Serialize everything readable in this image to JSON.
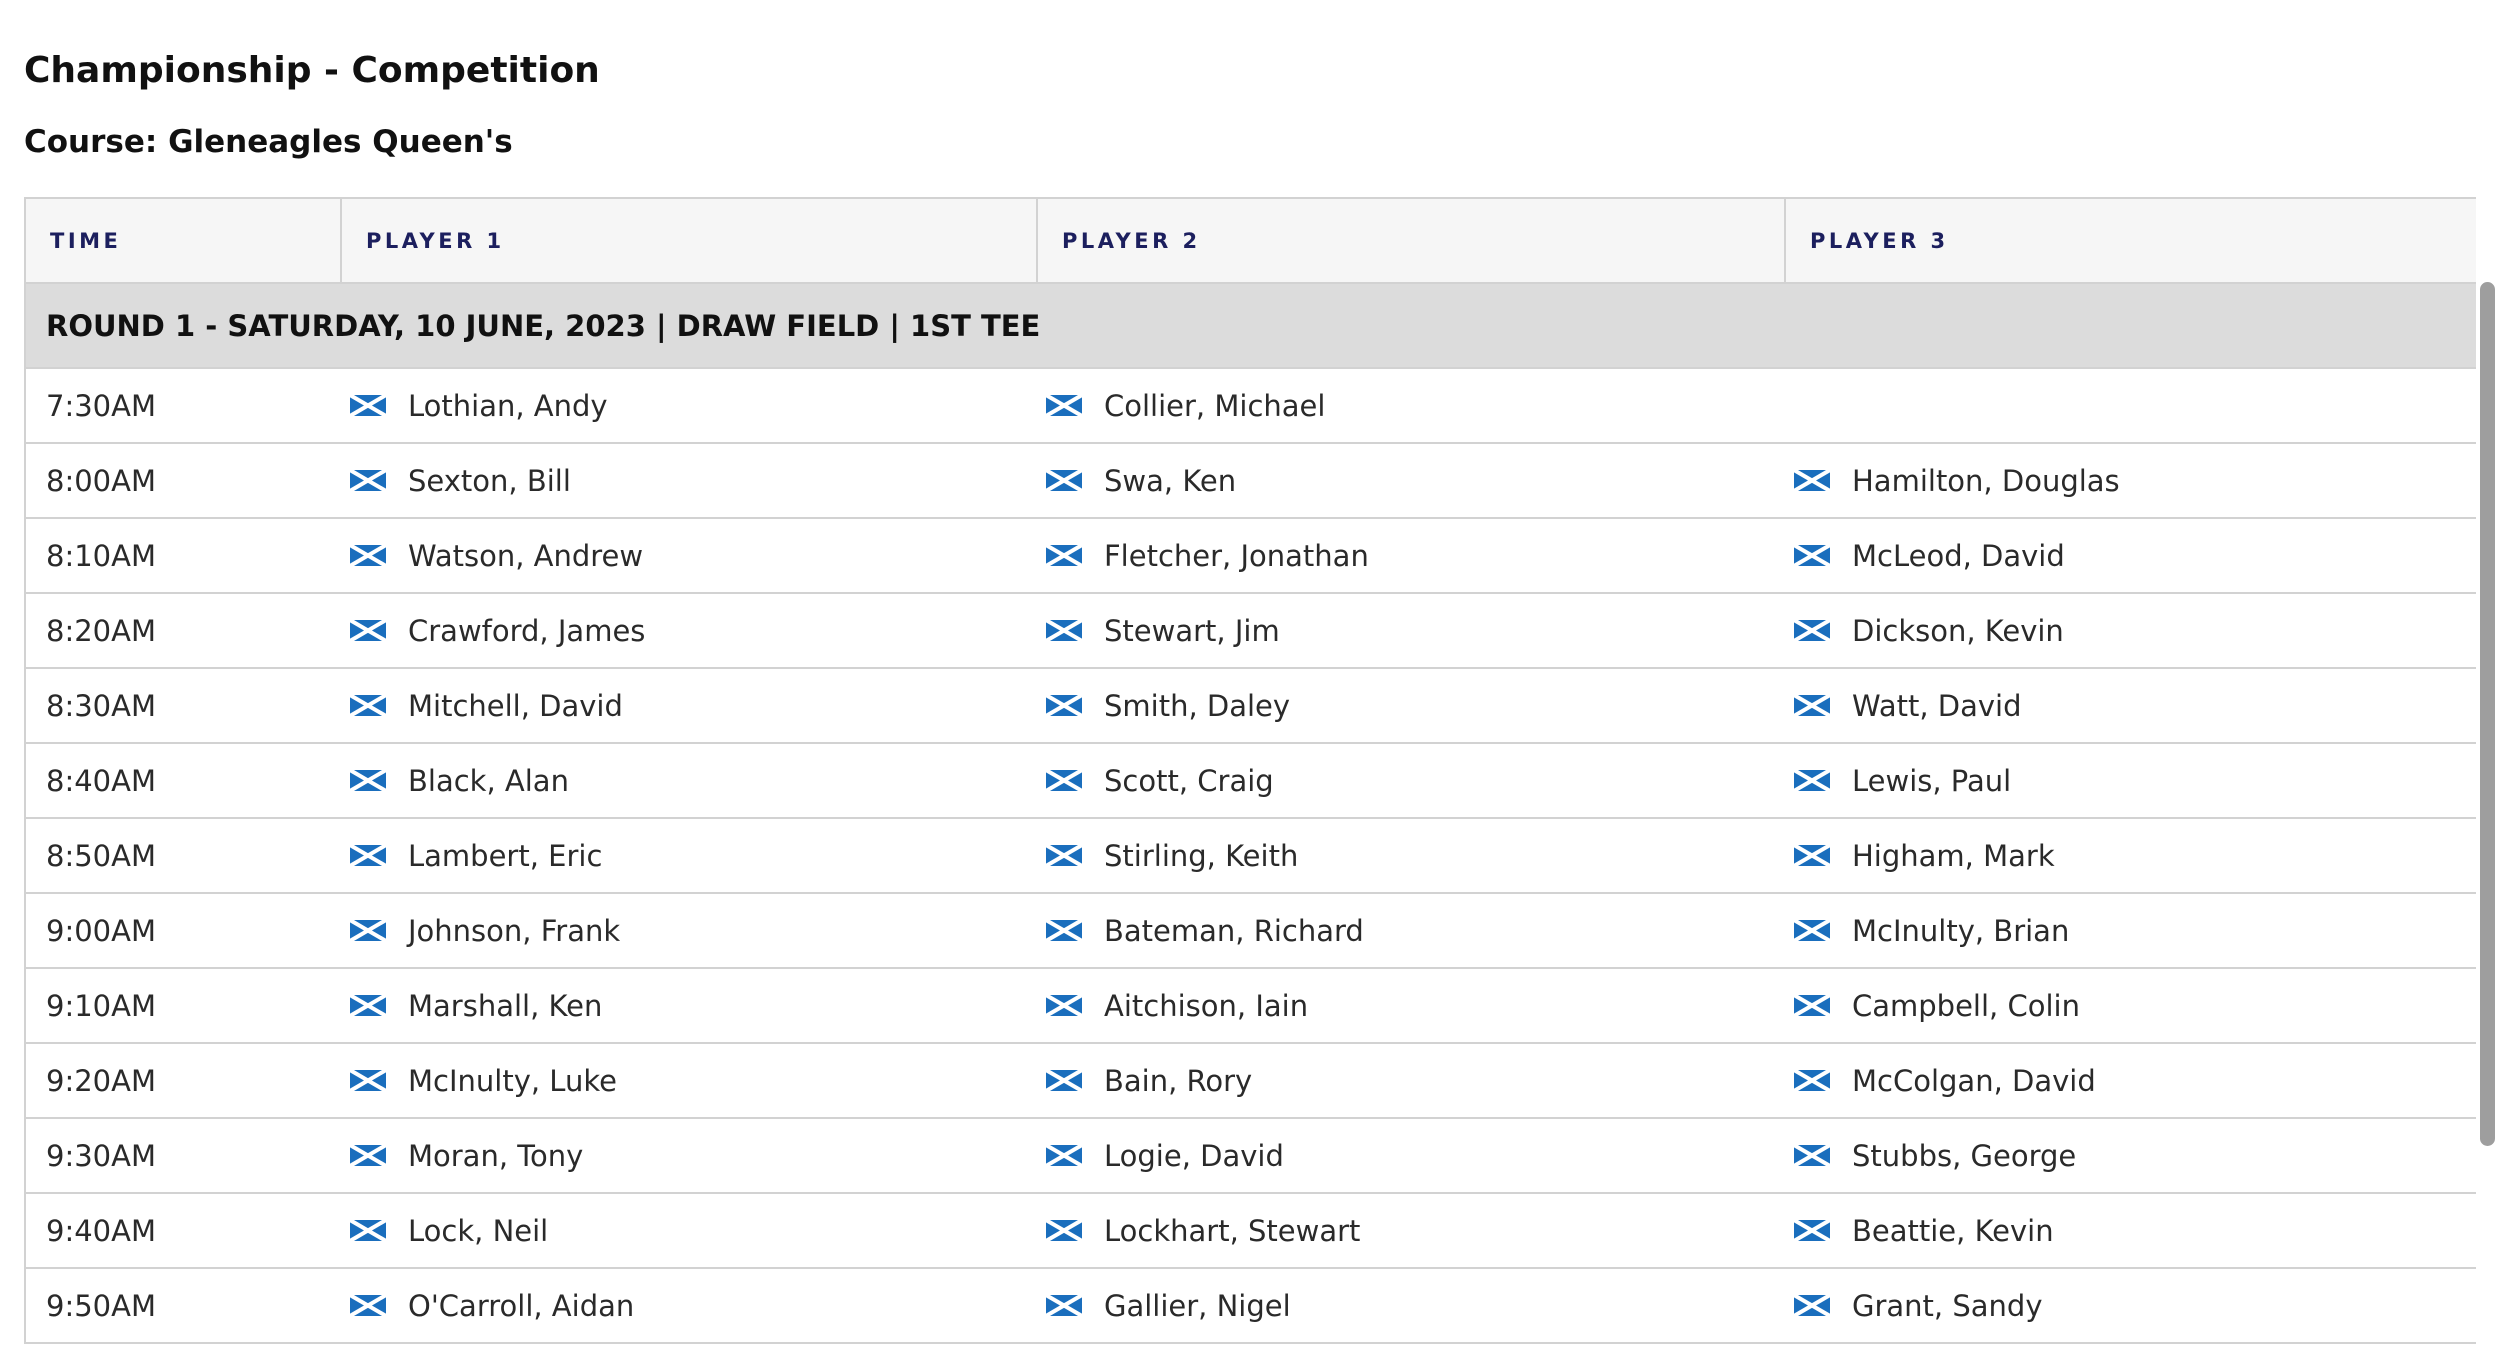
{
  "page": {
    "title": "Championship - Competition",
    "course": "Course: Gleneagles Queen's"
  },
  "table": {
    "headers": {
      "time": "TIME",
      "player1": "PLAYER 1",
      "player2": "PLAYER 2",
      "player3": "PLAYER 3"
    },
    "round_label": "ROUND 1 - SATURDAY, 10 JUNE, 2023 | DRAW FIELD | 1ST TEE",
    "flag_icon": "scotland-flag-icon",
    "flag_colors": {
      "blue": "#1a6ebd",
      "white": "#ffffff"
    },
    "rows": [
      {
        "time": "7:30AM",
        "p1": "Lothian, Andy",
        "p2": "Collier, Michael",
        "p3": ""
      },
      {
        "time": "8:00AM",
        "p1": "Sexton, Bill",
        "p2": "Swa, Ken",
        "p3": "Hamilton, Douglas"
      },
      {
        "time": "8:10AM",
        "p1": "Watson, Andrew",
        "p2": "Fletcher, Jonathan",
        "p3": "McLeod, David"
      },
      {
        "time": "8:20AM",
        "p1": "Crawford, James",
        "p2": "Stewart, Jim",
        "p3": "Dickson, Kevin"
      },
      {
        "time": "8:30AM",
        "p1": "Mitchell, David",
        "p2": "Smith, Daley",
        "p3": "Watt, David"
      },
      {
        "time": "8:40AM",
        "p1": "Black, Alan",
        "p2": "Scott, Craig",
        "p3": "Lewis, Paul"
      },
      {
        "time": "8:50AM",
        "p1": "Lambert, Eric",
        "p2": "Stirling, Keith",
        "p3": "Higham, Mark"
      },
      {
        "time": "9:00AM",
        "p1": "Johnson, Frank",
        "p2": "Bateman, Richard",
        "p3": "McInulty, Brian"
      },
      {
        "time": "9:10AM",
        "p1": "Marshall, Ken",
        "p2": "Aitchison, Iain",
        "p3": "Campbell, Colin"
      },
      {
        "time": "9:20AM",
        "p1": "McInulty, Luke",
        "p2": "Bain, Rory",
        "p3": "McColgan, David"
      },
      {
        "time": "9:30AM",
        "p1": "Moran, Tony",
        "p2": "Logie, David",
        "p3": "Stubbs, George"
      },
      {
        "time": "9:40AM",
        "p1": "Lock, Neil",
        "p2": "Lockhart, Stewart",
        "p3": "Beattie, Kevin"
      },
      {
        "time": "9:50AM",
        "p1": "O'Carroll, Aidan",
        "p2": "Gallier, Nigel",
        "p3": "Grant, Sandy"
      }
    ]
  }
}
